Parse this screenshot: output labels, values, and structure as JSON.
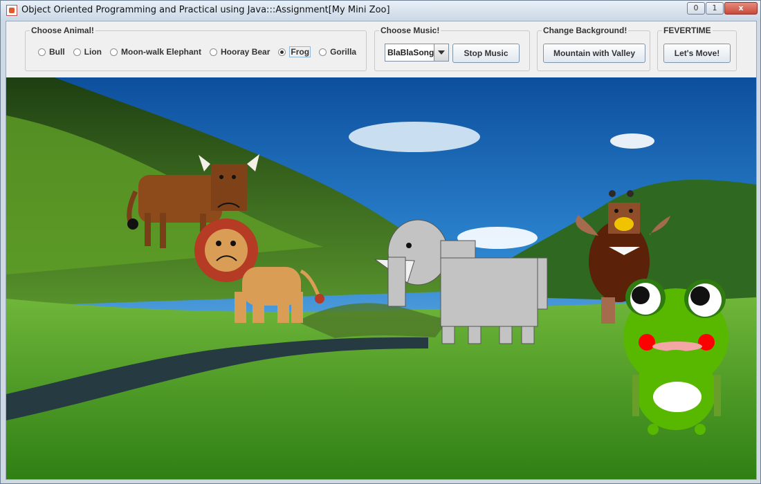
{
  "window": {
    "title": "Object Oriented Programming and Practical using Java:::Assignment[My Mini Zoo]",
    "min_label": "0",
    "max_label": "1",
    "close_label": "x"
  },
  "choose_animal": {
    "legend": "Choose Animal!",
    "options": [
      "Bull",
      "Lion",
      "Moon-walk Elephant",
      "Hooray Bear",
      "Frog",
      "Gorilla"
    ],
    "selected": "Frog"
  },
  "choose_music": {
    "legend": "Choose Music!",
    "selected_song": "BlaBlaSong",
    "stop_label": "Stop Music"
  },
  "change_background": {
    "legend": "Change Background!",
    "button_label": "Mountain with Valley"
  },
  "fevertime": {
    "legend": "FEVERTIME",
    "button_label": "Let's Move!"
  },
  "scene": {
    "animals": [
      "bull",
      "lion",
      "elephant",
      "bear",
      "frog"
    ],
    "colors": {
      "sky": "#1f6fb6",
      "grass": "#4f9e21",
      "mountain": "#2f5f1f",
      "river": "#23313a",
      "frog": "#58b800"
    }
  }
}
